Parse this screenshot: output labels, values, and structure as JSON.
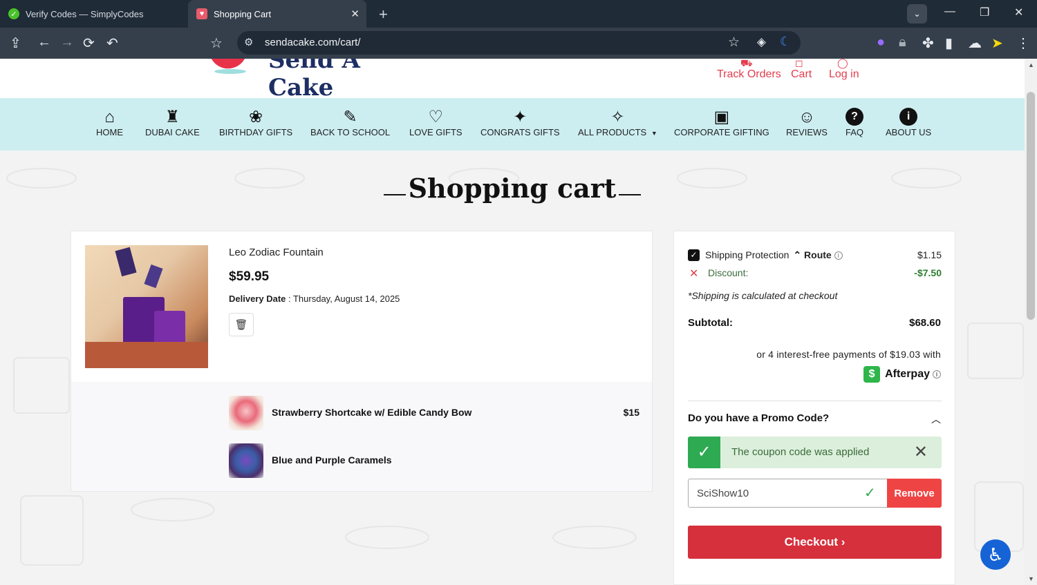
{
  "browser": {
    "tabs": [
      {
        "title": "Verify Codes — SimplyCodes",
        "active": false
      },
      {
        "title": "Shopping Cart",
        "active": true
      }
    ],
    "url": "sendacake.com/cart/"
  },
  "header": {
    "brand": "Send A Cake",
    "links": [
      {
        "label": "Track Orders",
        "icon": "truck-icon"
      },
      {
        "label": "Cart",
        "icon": "bag-icon"
      },
      {
        "label": "Log in",
        "icon": "user-icon"
      }
    ]
  },
  "nav": [
    {
      "label": "HOME",
      "icon": "⌂"
    },
    {
      "label": "DUBAI CAKE",
      "icon": "♜"
    },
    {
      "label": "BIRTHDAY GIFTS",
      "icon": "❀"
    },
    {
      "label": "BACK TO SCHOOL",
      "icon": "✎"
    },
    {
      "label": "LOVE GIFTS",
      "icon": "♡"
    },
    {
      "label": "CONGRATS GIFTS",
      "icon": "✦"
    },
    {
      "label": "ALL PRODUCTS",
      "icon": "✧"
    },
    {
      "label": "CORPORATE GIFTING",
      "icon": "▣"
    },
    {
      "label": "REVIEWS",
      "icon": "☺"
    },
    {
      "label": "FAQ",
      "icon": "?"
    },
    {
      "label": "ABOUT US",
      "icon": "i"
    }
  ],
  "page_title": "Shopping cart",
  "cart": {
    "item": {
      "name": "Leo Zodiac Fountain",
      "price": "$59.95",
      "delivery_label": "Delivery Date",
      "delivery_date": " : Thursday, August 14, 2025"
    },
    "addons": [
      {
        "name": "Strawberry Shortcake w/ Edible Candy Bow",
        "price": "$15"
      },
      {
        "name": "Blue and Purple Caramels",
        "price": ""
      }
    ]
  },
  "summary": {
    "shipping_protection_label": "Shipping Protection",
    "route_label": "Route",
    "shipping_protection_value": "$1.15",
    "discount_label": "Discount:",
    "discount_value": "-$7.50",
    "shipping_note": "*Shipping is calculated at checkout",
    "subtotal_label": "Subtotal:",
    "subtotal_value": "$68.60",
    "afterpay_text": "or 4 interest-free payments of $19.03 with",
    "afterpay_brand": "Afterpay",
    "promo_question": "Do you have a Promo Code?",
    "coupon_message": "The coupon code was applied",
    "promo_code": "SciShow10",
    "remove_label": "Remove",
    "checkout_label": "Checkout"
  },
  "colors": {
    "accent_red": "#d6303d",
    "nav_bg": "#cdeef1",
    "success_green": "#2eaa52"
  }
}
